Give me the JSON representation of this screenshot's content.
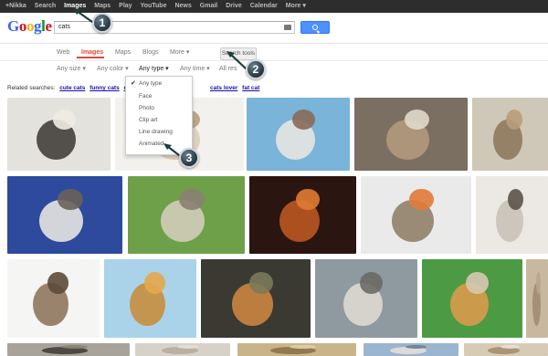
{
  "topbar": {
    "items": [
      "+Nikka",
      "Search",
      "Images",
      "Maps",
      "Play",
      "YouTube",
      "News",
      "Gmail",
      "Drive",
      "Calendar",
      "More ▾"
    ]
  },
  "logo": {
    "letters": [
      "G",
      "o",
      "o",
      "g",
      "l",
      "e"
    ]
  },
  "search": {
    "query": "cats"
  },
  "tabs": {
    "web": "Web",
    "images": "Images",
    "maps": "Maps",
    "blogs": "Blogs",
    "more": "More ▾",
    "search_tools": "Search tools"
  },
  "filters": {
    "size": "Any size ▾",
    "color": "Any color ▾",
    "type": "Any type ▾",
    "time": "Any time ▾",
    "all": "All res"
  },
  "related": {
    "label": "Related searches:",
    "links": [
      "cute cats",
      "funny cats",
      "catz",
      "cats lover",
      "fat cat"
    ]
  },
  "type_menu": {
    "items": [
      "Any type",
      "Face",
      "Photo",
      "Clip art",
      "Line drawing",
      "Animated"
    ],
    "checkmark": "✔"
  },
  "annotations": [
    "1",
    "2",
    "3"
  ],
  "colors": {
    "accent": "#dd4b39",
    "link": "#1a0dab",
    "button": "#4d90fe",
    "annotation": "#2a3d49",
    "topbar": "#2d2d2d"
  }
}
